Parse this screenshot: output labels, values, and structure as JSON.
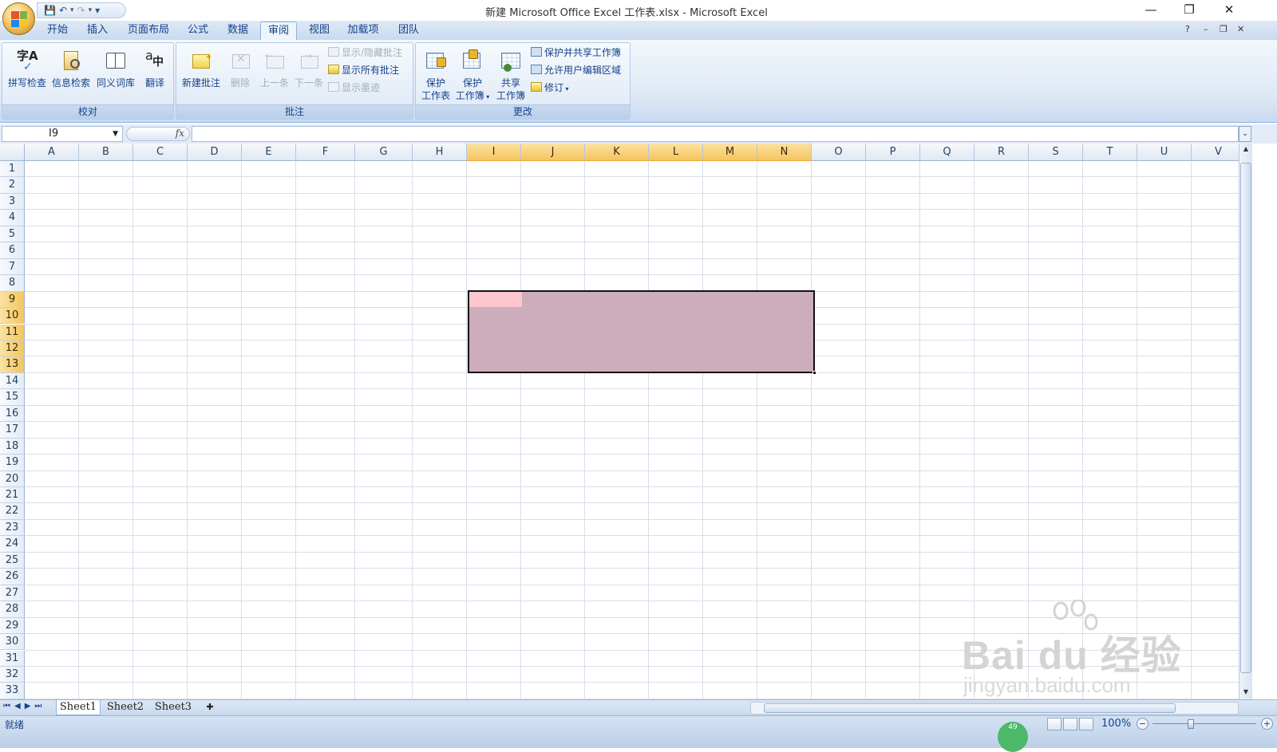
{
  "window": {
    "title": "新建 Microsoft Office Excel 工作表.xlsx - Microsoft Excel",
    "minimize": "—",
    "restore": "❐",
    "close": "✕"
  },
  "qat": {
    "save_icon": "save-icon",
    "undo_icon": "undo-icon",
    "redo_icon": "redo-icon",
    "customize": "▾"
  },
  "tabs": [
    "开始",
    "插入",
    "页面布局",
    "公式",
    "数据",
    "审阅",
    "视图",
    "加载项",
    "团队"
  ],
  "active_tab": "审阅",
  "ribbon_groups": {
    "proofing": {
      "label": "校对",
      "buttons": [
        "拼写检查",
        "信息检索",
        "同义词库",
        "翻译"
      ]
    },
    "comments": {
      "label": "批注",
      "new_comment": "新建批注",
      "delete": "删除",
      "previous": "上一条",
      "next": "下一条",
      "show_hide": "显示/隐藏批注",
      "show_all": "显示所有批注",
      "show_ink": "显示墨迹"
    },
    "changes": {
      "label": "更改",
      "protect_sheet_l1": "保护",
      "protect_sheet_l2": "工作表",
      "protect_workbook_l1": "保护",
      "protect_workbook_l2": "工作簿",
      "share_workbook_l1": "共享",
      "share_workbook_l2": "工作簿",
      "protect_share": "保护并共享工作簿",
      "allow_edit": "允许用户编辑区域",
      "track_changes": "修订"
    }
  },
  "formula_bar": {
    "name_box": "I9",
    "fx": "fx",
    "value": ""
  },
  "columns": [
    "A",
    "B",
    "C",
    "D",
    "E",
    "F",
    "G",
    "H",
    "I",
    "J",
    "K",
    "L",
    "M",
    "N",
    "O",
    "P",
    "Q",
    "R",
    "S",
    "T",
    "U",
    "V"
  ],
  "rows": [
    "1",
    "2",
    "3",
    "4",
    "5",
    "6",
    "7",
    "8",
    "9",
    "10",
    "11",
    "12",
    "13",
    "14",
    "15",
    "16",
    "17",
    "18",
    "19",
    "20",
    "21",
    "22",
    "23",
    "24",
    "25",
    "26",
    "27",
    "28",
    "29",
    "30",
    "31",
    "32",
    "33"
  ],
  "selection": {
    "range": "I9:N13",
    "active_cell": "I9",
    "fill_color": "#cdadbb",
    "active_fill": "#fcc6cf"
  },
  "sheets": [
    "Sheet1",
    "Sheet2",
    "Sheet3"
  ],
  "active_sheet": "Sheet1",
  "status": {
    "text": "就绪",
    "zoom": "100%"
  },
  "watermark": {
    "brand": "Bai du 经验",
    "url": "jingyan.baidu.com"
  },
  "badge": "49"
}
